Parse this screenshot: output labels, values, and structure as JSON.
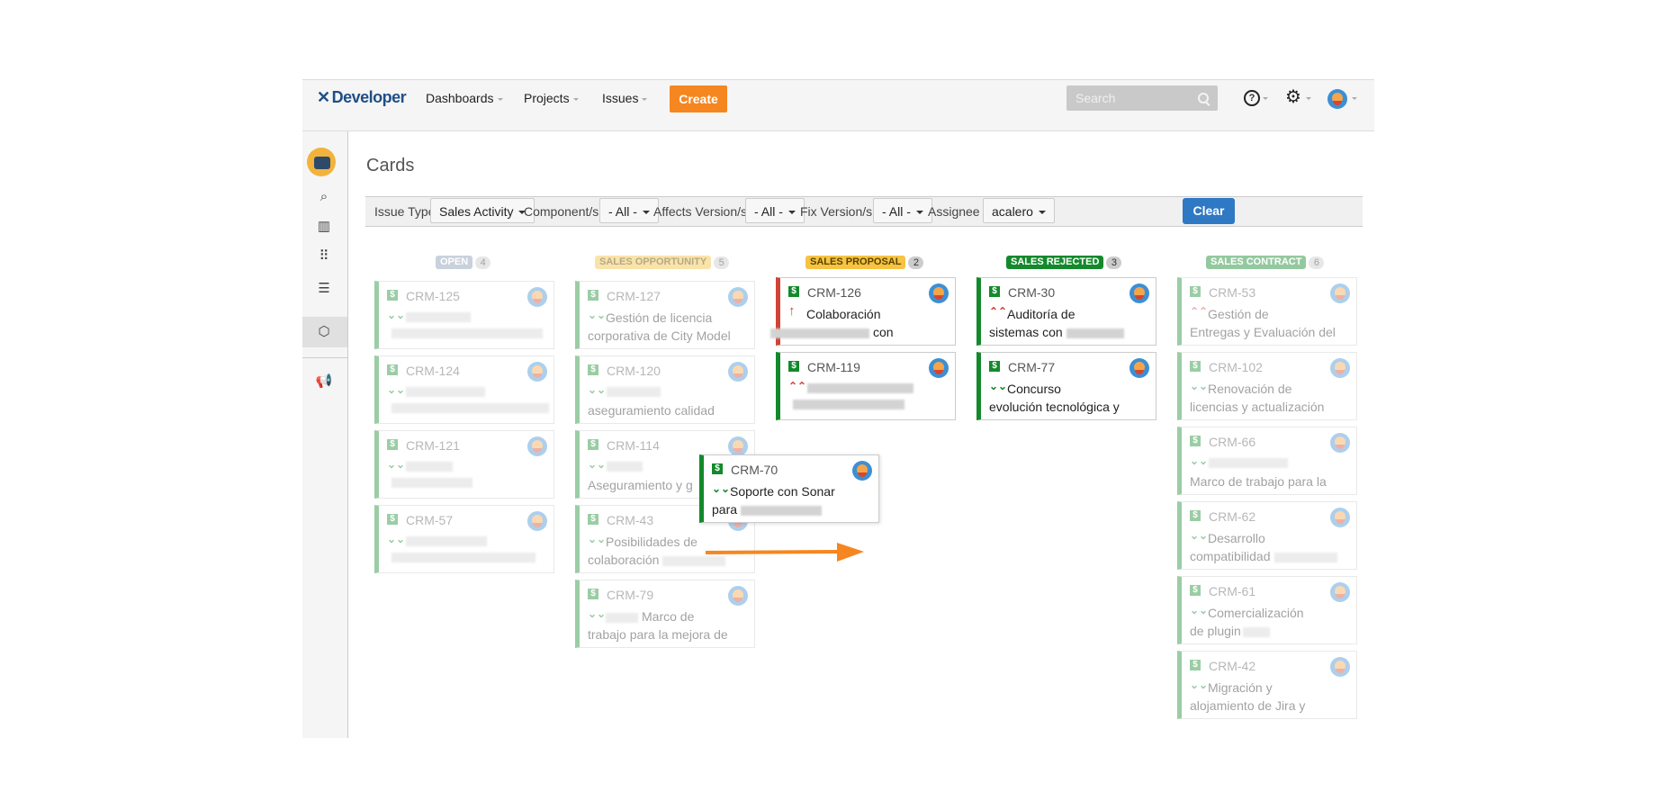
{
  "header": {
    "logo": "Developer",
    "nav": [
      {
        "label": "Dashboards"
      },
      {
        "label": "Projects"
      },
      {
        "label": "Issues"
      }
    ],
    "create_label": "Create",
    "search_placeholder": "Search",
    "help_glyph": "?"
  },
  "page_title": "Cards",
  "filters": {
    "issue_type_label": "Issue Type",
    "issue_type_value": "Sales Activity",
    "component_label": "Component/s",
    "component_value": "- All -",
    "affects_label": "Affects Version/s",
    "affects_value": "- All -",
    "fix_label": "Fix Version/s",
    "fix_value": "- All -",
    "assignee_label": "Assignee",
    "assignee_value": "acalero",
    "clear_label": "Clear"
  },
  "columns": [
    {
      "label": "OPEN",
      "count": "4",
      "color": "#8a9bb2",
      "faded": true
    },
    {
      "label": "SALES OPPORTUNITY",
      "count": "5",
      "color": "#f6c342",
      "faded": true
    },
    {
      "label": "SALES PROPOSAL",
      "count": "2",
      "color": "#f6c342",
      "faded": false
    },
    {
      "label": "SALES REJECTED",
      "count": "3",
      "color": "#14892c",
      "faded": false
    },
    {
      "label": "SALES CONTRACT",
      "count": "6",
      "color": "#14892c",
      "faded": true
    }
  ],
  "cards": {
    "open": [
      {
        "key": "CRM-125",
        "line1": "",
        "line2": ""
      },
      {
        "key": "CRM-124",
        "line1": "",
        "line2": ""
      },
      {
        "key": "CRM-121",
        "line1": "",
        "line2": ""
      },
      {
        "key": "CRM-57",
        "line1": "",
        "line2": ""
      }
    ],
    "opportunity": [
      {
        "key": "CRM-127",
        "line1": "Gestión de licencia",
        "line2": "corporativa de City Model"
      },
      {
        "key": "CRM-120",
        "line1": "",
        "line2": "aseguramiento calidad"
      },
      {
        "key": "CRM-114",
        "line1": "",
        "line2": "Aseguramiento y g"
      },
      {
        "key": "CRM-43",
        "line1": "Posibilidades de",
        "line2": "colaboración"
      },
      {
        "key": "CRM-79",
        "line1": "Marco de",
        "line2": "trabajo para la mejora de"
      }
    ],
    "proposal": [
      {
        "key": "CRM-126",
        "line1": "Colaboración",
        "line2": "con"
      },
      {
        "key": "CRM-119",
        "line1": "",
        "line2": ""
      }
    ],
    "rejected": [
      {
        "key": "CRM-30",
        "line1": "Auditoría de",
        "line2": "sistemas con"
      },
      {
        "key": "CRM-77",
        "line1": "Concurso",
        "line2": "evolución tecnológica y"
      }
    ],
    "contract": [
      {
        "key": "CRM-53",
        "line1": "Gestión de",
        "line2": "Entregas y Evaluación del"
      },
      {
        "key": "CRM-102",
        "line1": "Renovación de",
        "line2": "licencias y actualización"
      },
      {
        "key": "CRM-66",
        "line1": "",
        "line2": "Marco de trabajo para la"
      },
      {
        "key": "CRM-62",
        "line1": "Desarrollo",
        "line2": "compatibilidad"
      },
      {
        "key": "CRM-61",
        "line1": "Comercialización",
        "line2": "de plugin"
      },
      {
        "key": "CRM-42",
        "line1": "Migración y",
        "line2": "alojamiento de Jira y"
      }
    ],
    "dragging": {
      "key": "CRM-70",
      "line1": "Soporte con Sonar",
      "line2": "para"
    }
  },
  "glyphs": {
    "issue_type": "$",
    "priority_low": "⌄⌄",
    "priority_high": "⌃⌃",
    "priority_highest": "↑"
  },
  "colors": {
    "accent": "#f6861f",
    "primary": "#2f78c4",
    "success": "#14892c",
    "danger": "#d04437"
  }
}
